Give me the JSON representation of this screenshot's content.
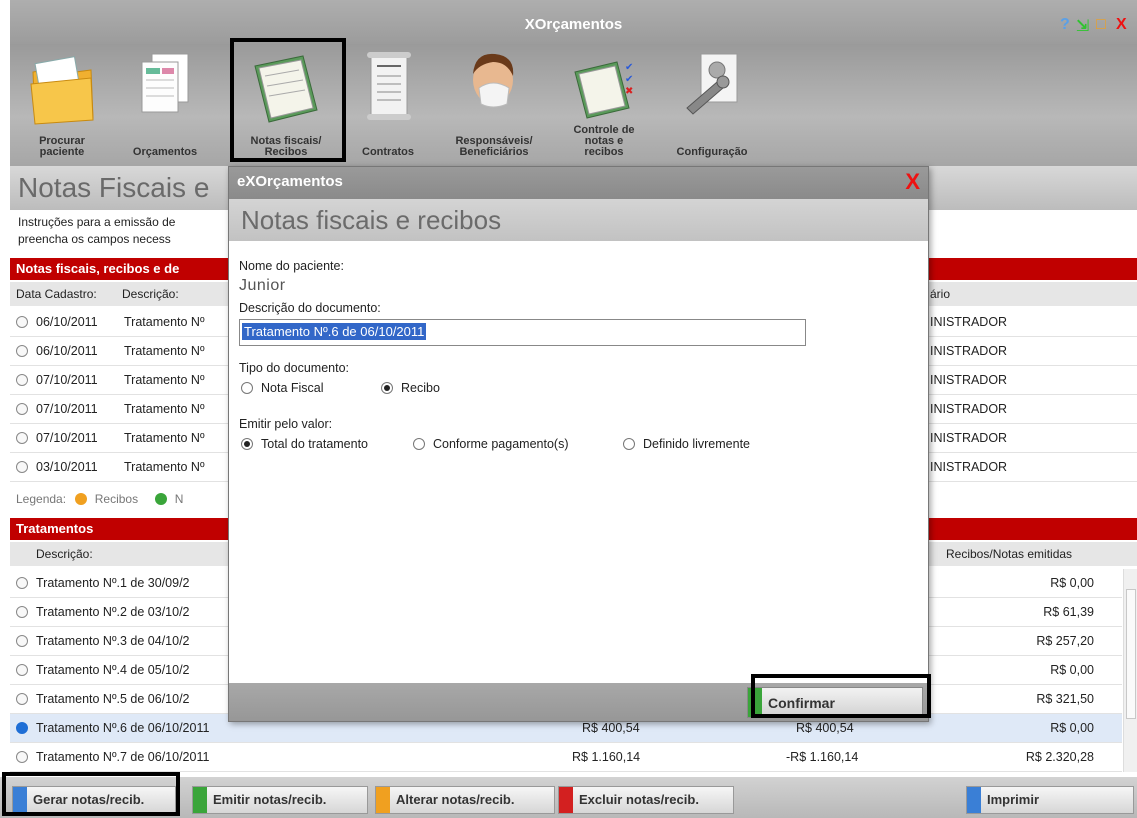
{
  "window": {
    "title": "XOrçamentos",
    "help": "?",
    "minimize": "⇲",
    "maximize": "□",
    "close": "X"
  },
  "toolbar": {
    "items": [
      {
        "label": "Procurar\npaciente",
        "icon": "folder-pacientes-icon"
      },
      {
        "label": "Orçamentos",
        "icon": "budget-sheets-icon"
      },
      {
        "label": "Notas fiscais/\nRecibos",
        "icon": "invoice-clipboard-icon"
      },
      {
        "label": "Contratos",
        "icon": "contract-scroll-icon"
      },
      {
        "label": "Responsáveis/\nBeneficiários",
        "icon": "person-mask-icon"
      },
      {
        "label": "Controle de\nnotas e\nrecibos",
        "icon": "checklist-icon"
      },
      {
        "label": "Configuração",
        "icon": "tools-icon"
      }
    ]
  },
  "page": {
    "title": "Notas Fiscais e",
    "instructions_line1": "Instruções para a emissão de",
    "instructions_line2": "preencha os campos necess"
  },
  "notes_section": {
    "header": "Notas fiscais, recibos e de",
    "columns": {
      "date": "Data Cadastro:",
      "description": "Descrição:",
      "user": "ário"
    },
    "rows": [
      {
        "date": "06/10/2011",
        "description": "Tratamento Nº",
        "user": "INISTRADOR"
      },
      {
        "date": "06/10/2011",
        "description": "Tratamento Nº",
        "user": "INISTRADOR"
      },
      {
        "date": "07/10/2011",
        "description": "Tratamento Nº",
        "user": "INISTRADOR"
      },
      {
        "date": "07/10/2011",
        "description": "Tratamento Nº",
        "user": "INISTRADOR"
      },
      {
        "date": "07/10/2011",
        "description": "Tratamento Nº",
        "user": "INISTRADOR"
      },
      {
        "date": "03/10/2011",
        "description": "Tratamento Nº",
        "user": "INISTRADOR"
      }
    ],
    "legend_label": "Legenda:",
    "legend_recibos": "Recibos",
    "legend_other": "N",
    "legend_colors": {
      "recibos": "#f0a020",
      "other": "#3aa53a"
    }
  },
  "treatments": {
    "header": "Tratamentos",
    "columns": {
      "description": "Descrição:",
      "issued": "Recibos/Notas emitidas"
    },
    "rows": [
      {
        "description": "Tratamento Nº.1 de 30/09/2",
        "value1": "",
        "value2": "",
        "issued": "R$ 0,00"
      },
      {
        "description": "Tratamento Nº.2 de 03/10/2",
        "value1": "",
        "value2": "",
        "issued": "R$ 61,39"
      },
      {
        "description": "Tratamento Nº.3 de 04/10/2",
        "value1": "",
        "value2": "",
        "issued": "R$ 257,20"
      },
      {
        "description": "Tratamento Nº.4 de 05/10/2",
        "value1": "",
        "value2": "",
        "issued": "R$ 0,00"
      },
      {
        "description": "Tratamento Nº.5 de 06/10/2",
        "value1": "",
        "value2": "",
        "issued": "R$ 321,50"
      },
      {
        "description": "Tratamento Nº.6 de 06/10/2011",
        "value1": "R$ 400,54",
        "value2": "R$ 400,54",
        "issued": "R$ 0,00"
      },
      {
        "description": "Tratamento Nº.7 de 06/10/2011",
        "value1": "R$ 1.160,14",
        "value2": "-R$ 1.160,14",
        "issued": "R$ 2.320,28"
      }
    ]
  },
  "bottom_buttons": [
    {
      "label": "Gerar notas/recib.",
      "color": "#3a7fd6"
    },
    {
      "label": "Emitir notas/recib.",
      "color": "#3aa53a"
    },
    {
      "label": "Alterar notas/recib.",
      "color": "#f0a020"
    },
    {
      "label": "Excluir notas/recib.",
      "color": "#d32020"
    },
    {
      "label": "Imprimir",
      "color": "#3a7fd6"
    }
  ],
  "dialog": {
    "window_title": "eXOrçamentos",
    "close": "X",
    "heading": "Notas fiscais e recibos",
    "patient_label": "Nome do paciente:",
    "patient_name": "Junior",
    "description_label": "Descrição do documento:",
    "description_value": "Tratamento Nº.6 de 06/10/2011",
    "doc_type_label": "Tipo do documento:",
    "doc_type_options": [
      "Nota Fiscal",
      "Recibo"
    ],
    "doc_type_selected": "Recibo",
    "value_label": "Emitir pelo valor:",
    "value_options": [
      "Total do tratamento",
      "Conforme pagamento(s)",
      "Definido livremente"
    ],
    "value_selected": "Total do tratamento",
    "confirm": "Confirmar"
  }
}
